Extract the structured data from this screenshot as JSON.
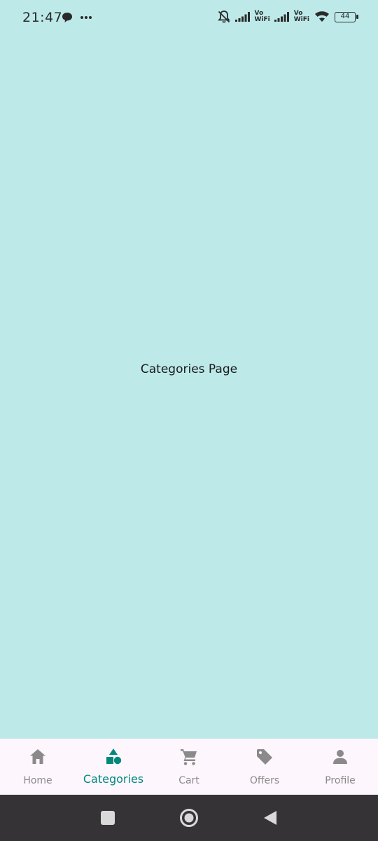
{
  "status_bar": {
    "time": "21:47",
    "battery": "44",
    "volte_1_top": "Vo",
    "volte_1_bottom": "WiFi",
    "volte_2_top": "Vo",
    "volte_2_bottom": "WiFi"
  },
  "main": {
    "page_label": "Categories Page"
  },
  "bottom_nav": {
    "active_color": "#00897b",
    "inactive_color": "#8a8a8a",
    "items": [
      {
        "label": "Home",
        "icon": "home-icon"
      },
      {
        "label": "Categories",
        "icon": "category-icon"
      },
      {
        "label": "Cart",
        "icon": "cart-icon"
      },
      {
        "label": "Offers",
        "icon": "tag-icon"
      },
      {
        "label": "Profile",
        "icon": "person-icon"
      }
    ]
  }
}
